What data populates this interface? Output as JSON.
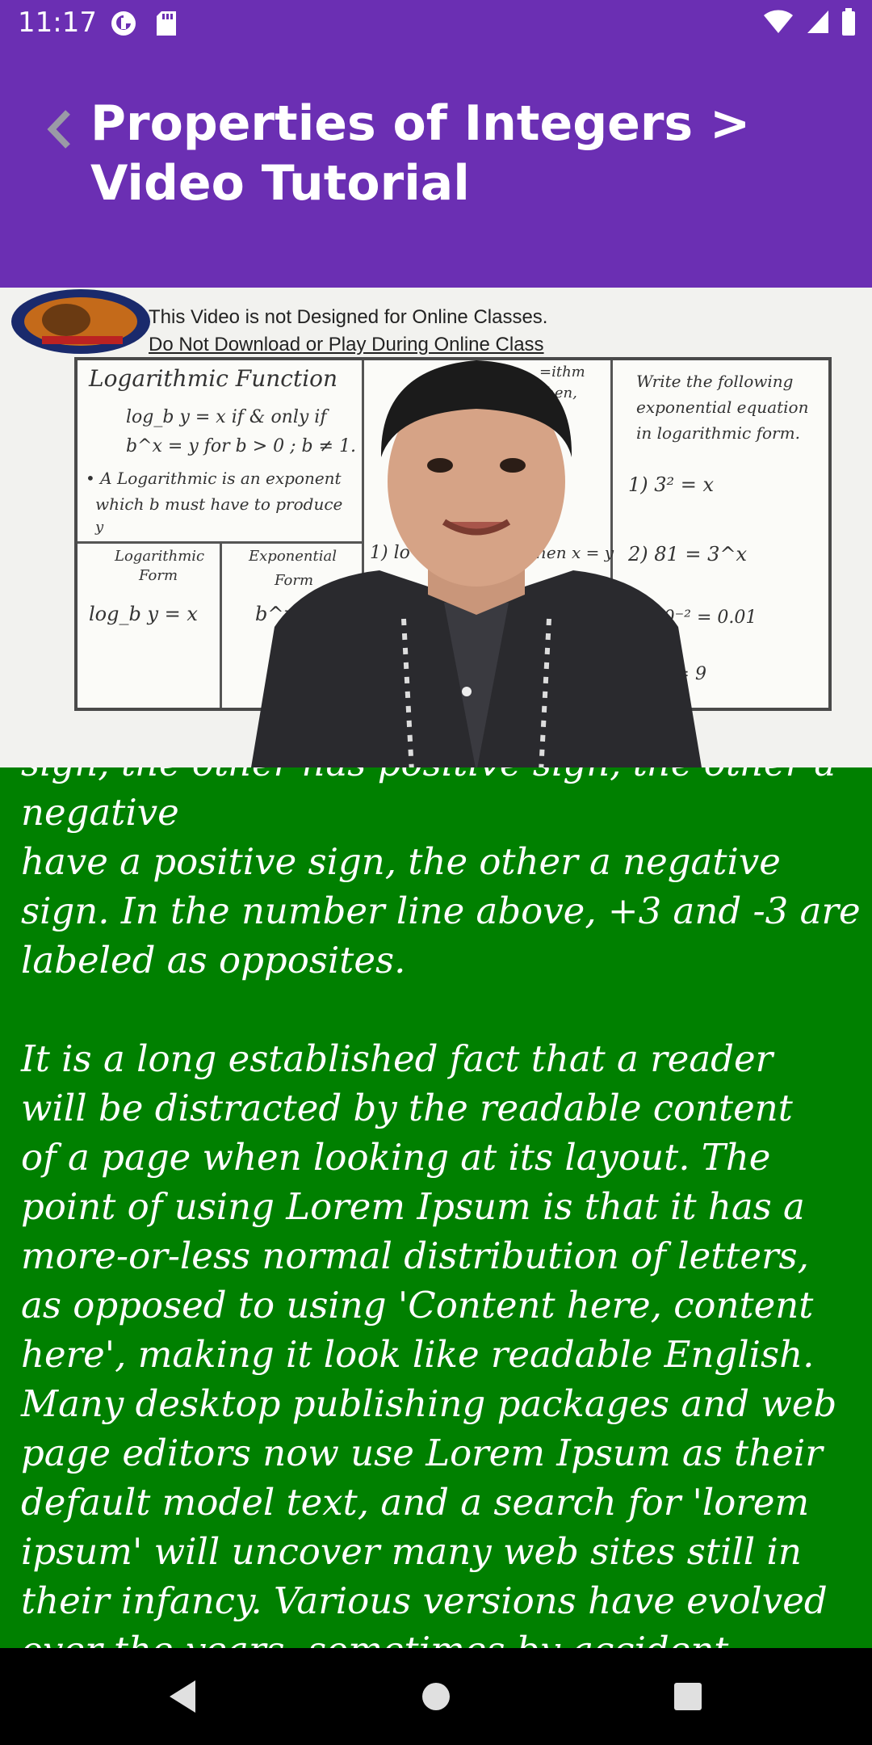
{
  "status_bar": {
    "time": "11:17",
    "left_icons": [
      "data-saver-icon",
      "sd-card-icon"
    ],
    "right_icons": [
      "wifi-icon",
      "signal-icon",
      "battery-icon"
    ]
  },
  "app_bar": {
    "title": "Properties of Integers > Video Tutorial",
    "back_icon": "chevron-left-icon",
    "background": "#6b2fb3"
  },
  "video": {
    "watermark_line1": "This Video is not Designed for Online Classes.",
    "watermark_line2": "Do Not Download or Play During Online Class",
    "board": {
      "left_title": "Logarithmic  Function",
      "def1": "log_b y = x  if & only if",
      "def2": "b^x = y  for  b > 0 ; b ≠ 1.",
      "def3": "• A Logarithmic  is  an exponent",
      "def4": "which  b  must  have  to  produce",
      "def5": "y",
      "col_log_form_1": "Logarithmic",
      "col_log_form_2": "Form",
      "col_exp_form_1": "Exponential",
      "col_exp_form_2": "Form",
      "log_expr": "log_b y = x",
      "exp_expr": "b^x = y",
      "mid_1": "1)  lo",
      "mid_2": "then  x = y",
      "mid_3": "=ithm",
      "mid_4": "then,",
      "right_title_1": "Write  the  following",
      "right_title_2": "exponential  equation",
      "right_title_3": "in  logarithmic  form.",
      "ex1": "1)  3² = x",
      "ex2": "2)  81 = 3^x",
      "ex3": "3)  10⁻² = 0.01",
      "ex4": "4)  ... = 9"
    }
  },
  "content": {
    "text": "sign, the other has positive sign, the other a negative\nhave a positive sign, the other a negative\nsign. In the number line above, +3 and -3 are\nlabeled as opposites.\n\nIt is a long established fact that a reader\nwill be distracted by the readable content\nof a page when looking at its layout. The\npoint of using Lorem Ipsum is that it has a\nmore-or-less normal distribution of letters,\nas opposed to using 'Content here, content\nhere', making it look like readable English.\nMany desktop publishing packages and web\npage editors now use Lorem Ipsum as their\ndefault model text, and a search for 'lorem\nipsum' will uncover many web sites still in\ntheir infancy. Various versions have evolved\nover the years, sometimes by accident,\nsometimes on purpose (injected humour and",
    "background": "#008000"
  },
  "nav_bar": {
    "buttons": [
      "back-triangle-icon",
      "home-circle-icon",
      "recents-square-icon"
    ]
  }
}
